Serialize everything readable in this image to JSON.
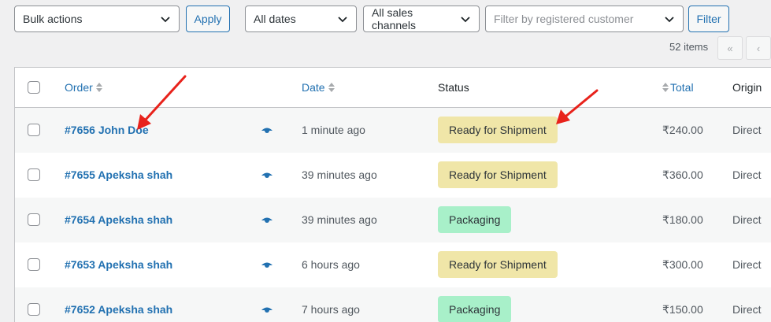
{
  "toolbar": {
    "bulk_actions": "Bulk actions",
    "apply_label": "Apply",
    "dates_filter": "All dates",
    "channels_filter": "All sales channels",
    "customer_placeholder": "Filter by registered customer",
    "filter_label": "Filter"
  },
  "pagination": {
    "items_count": "52 items",
    "first_label": "«",
    "prev_label": "‹"
  },
  "table": {
    "headers": {
      "order": "Order",
      "date": "Date",
      "status": "Status",
      "total": "Total",
      "origin": "Origin"
    },
    "rows": [
      {
        "order": "#7656 John Doe",
        "date": "1 minute ago",
        "status": "Ready for Shipment",
        "total": "₹240.00",
        "origin": "Direct"
      },
      {
        "order": "#7655 Apeksha shah",
        "date": "39 minutes ago",
        "status": "Ready for Shipment",
        "total": "₹360.00",
        "origin": "Direct"
      },
      {
        "order": "#7654 Apeksha shah",
        "date": "39 minutes ago",
        "status": "Packaging",
        "total": "₹180.00",
        "origin": "Direct"
      },
      {
        "order": "#7653 Apeksha shah",
        "date": "6 hours ago",
        "status": "Ready for Shipment",
        "total": "₹300.00",
        "origin": "Direct"
      },
      {
        "order": "#7652 Apeksha shah",
        "date": "7 hours ago",
        "status": "Packaging",
        "total": "₹150.00",
        "origin": "Direct"
      }
    ]
  },
  "colors": {
    "link": "#2271b1",
    "ready_for_shipment_bg": "#f0e6a8",
    "packaging_bg": "#a8f0c9",
    "annotation_arrow": "#e8221b"
  }
}
